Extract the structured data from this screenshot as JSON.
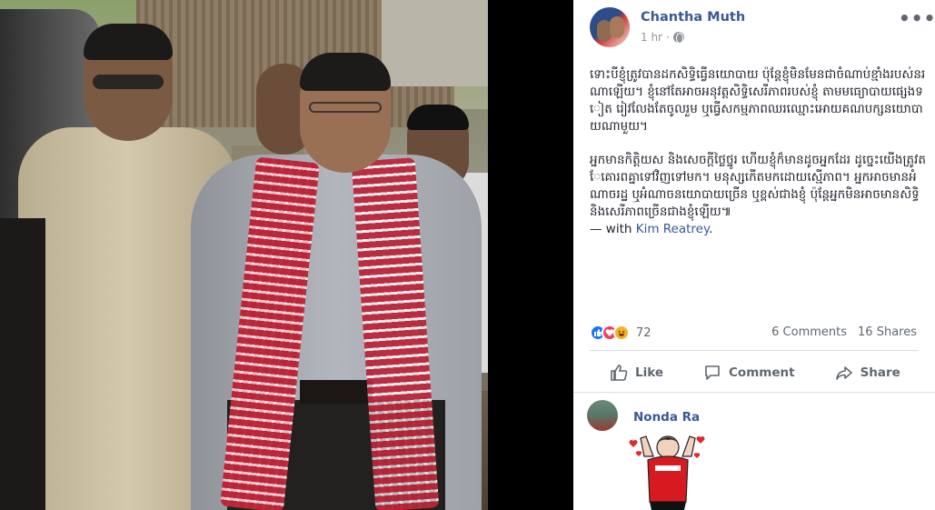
{
  "post": {
    "author": "Chantha Muth",
    "time": "1 hr",
    "more_label": "•••",
    "paragraphs": [
      "ទោះបីខ្ញុំត្រូវបានដកសិទ្ធិធ្វើនយោបាយ ប៉ុន្តែខ្ញុំមិនមែនជាចំណាប់ខ្មាំងរបស់នរណាឡើយ។ ខ្ញុំនៅតែអាចអនុវត្តសិទ្ធិសេរីភាពរបស់ខ្ញុំ តាមមធ្យោបាយផ្សេងទៀត រៀវលែងតែចូលរួម ឬធ្វើសកម្មភាពឈរឈ្មោះអោយគណបក្សនយោបាយណាមួយ។",
      "អ្នកមានកិត្តិយស និងសេចក្តីថ្លៃថ្នូរ ហើយខ្ញុំក៏មានដូចអ្នកដែរ ដូច្នេះយើងត្រូវតែគោរពគ្នាទៅវិញទៅមក។ មនុស្សកើតមកដោយស្មើភាព។ អ្នកអាចមានអំណាចរដ្ឋ ឬអំណាចនយោបាយច្រើន ឬខ្ពស់ជាងខ្ញុំ ប៉ុន្តែអ្នកមិនអាចមានសិទ្ធិ និងសេរីភាពច្រើនជាងខ្ញុំឡើយ៕"
    ],
    "with_prefix": "— with",
    "with_name": "Kim Reatrey",
    "with_suffix": "."
  },
  "reactions": {
    "count": "72",
    "types": [
      "like",
      "love",
      "haha"
    ]
  },
  "stats": {
    "comments": "6 Comments",
    "shares": "16 Shares"
  },
  "actions": {
    "like": "Like",
    "comment": "Comment",
    "share": "Share"
  },
  "comment": {
    "author": "Nonda Ra"
  }
}
